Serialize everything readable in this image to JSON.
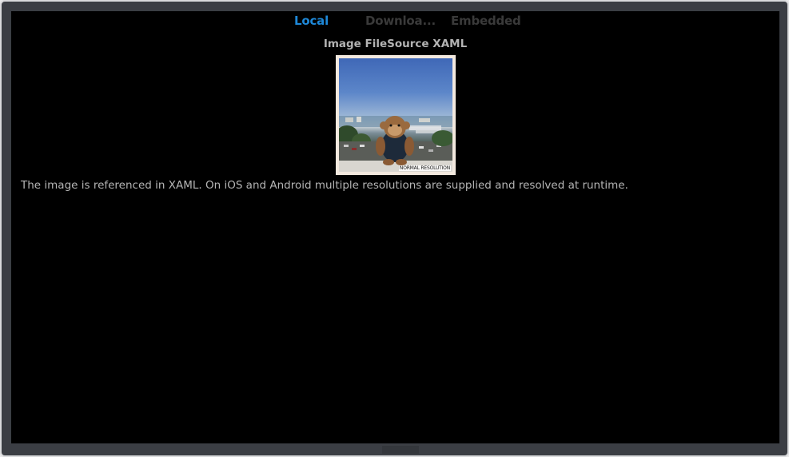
{
  "tabs": [
    {
      "label": "Local",
      "active": true
    },
    {
      "label": "Downloa...",
      "active": false
    },
    {
      "label": "Embedded",
      "active": false
    }
  ],
  "page": {
    "title": "Image FileSource XAML",
    "image_caption": "NORMAL RESOLUTION",
    "description": "The image is referenced in XAML. On iOS and Android multiple resolutions are supplied and resolved at runtime."
  },
  "colors": {
    "accent_tab": "#1e88d8",
    "inactive_tab": "#3a3a3a",
    "background": "#000000",
    "text": "#b5b5b5"
  }
}
